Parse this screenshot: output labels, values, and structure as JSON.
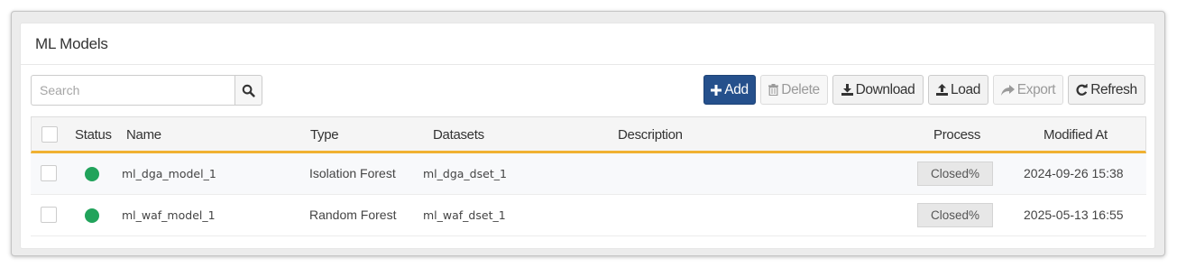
{
  "panel": {
    "title": "ML Models"
  },
  "search": {
    "placeholder": "Search"
  },
  "toolbar": {
    "add": "Add",
    "delete": "Delete",
    "download": "Download",
    "load": "Load",
    "export": "Export",
    "refresh": "Refresh"
  },
  "table": {
    "headers": {
      "status": "Status",
      "name": "Name",
      "type": "Type",
      "datasets": "Datasets",
      "description": "Description",
      "process": "Process",
      "modified": "Modified At"
    },
    "rows": [
      {
        "status": "active",
        "status_color": "#21a35b",
        "name": "ml_dga_model_1",
        "type": "Isolation Forest",
        "datasets": "ml_dga_dset_1",
        "description": "",
        "process": "Closed%",
        "modified": "2024-09-26 15:38"
      },
      {
        "status": "active",
        "status_color": "#21a35b",
        "name": "ml_waf_model_1",
        "type": "Random Forest",
        "datasets": "ml_waf_dset_1",
        "description": "",
        "process": "Closed%",
        "modified": "2025-05-13 16:55"
      }
    ]
  },
  "colors": {
    "primary": "#25508c",
    "header_accent": "#f0b132",
    "status_ok": "#21a35b"
  },
  "icons": {
    "search": "search-icon",
    "add": "plus-icon",
    "delete": "trash-icon",
    "download": "download-icon",
    "load": "upload-icon",
    "export": "share-arrow-icon",
    "refresh": "refresh-icon"
  }
}
